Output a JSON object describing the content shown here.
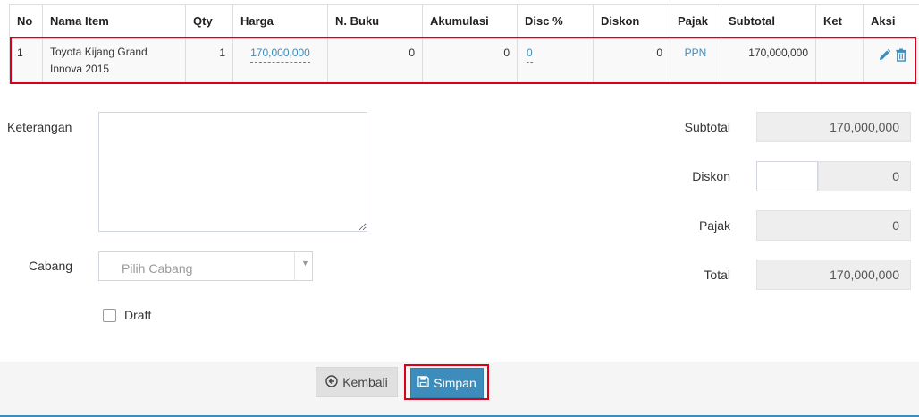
{
  "table": {
    "headers": {
      "no": "No",
      "item_name": "Nama Item",
      "qty": "Qty",
      "price": "Harga",
      "book_value": "N. Buku",
      "accumulation": "Akumulasi",
      "disc_pct": "Disc %",
      "discount": "Diskon",
      "tax": "Pajak",
      "subtotal": "Subtotal",
      "note": "Ket",
      "action": "Aksi"
    },
    "rows": [
      {
        "no": "1",
        "item_name": "Toyota Kijang Grand Innova 2015",
        "qty": "1",
        "price": "170,000,000",
        "book_value": "0",
        "accumulation": "0",
        "disc_pct": "0",
        "discount": "0",
        "tax": "PPN",
        "subtotal": "170,000,000",
        "note": ""
      }
    ]
  },
  "form": {
    "note_label": "Keterangan",
    "note_value": "",
    "branch_label": "Cabang",
    "branch_placeholder": "Pilih Cabang",
    "draft_label": "Draft"
  },
  "totals": {
    "subtotal_label": "Subtotal",
    "subtotal_value": "170,000,000",
    "discount_label": "Diskon",
    "discount_input": "",
    "discount_value": "0",
    "tax_label": "Pajak",
    "tax_value": "0",
    "total_label": "Total",
    "total_value": "170,000,000"
  },
  "footer": {
    "back_label": "Kembali",
    "save_label": "Simpan"
  },
  "colors": {
    "accent": "#3c8dbc",
    "highlight": "#d9001b"
  },
  "icons": {
    "edit": "pencil-icon",
    "delete": "trash-icon",
    "back": "circle-arrow-left-icon",
    "save": "floppy-disk-icon",
    "dropdown": "caret-down-icon"
  }
}
